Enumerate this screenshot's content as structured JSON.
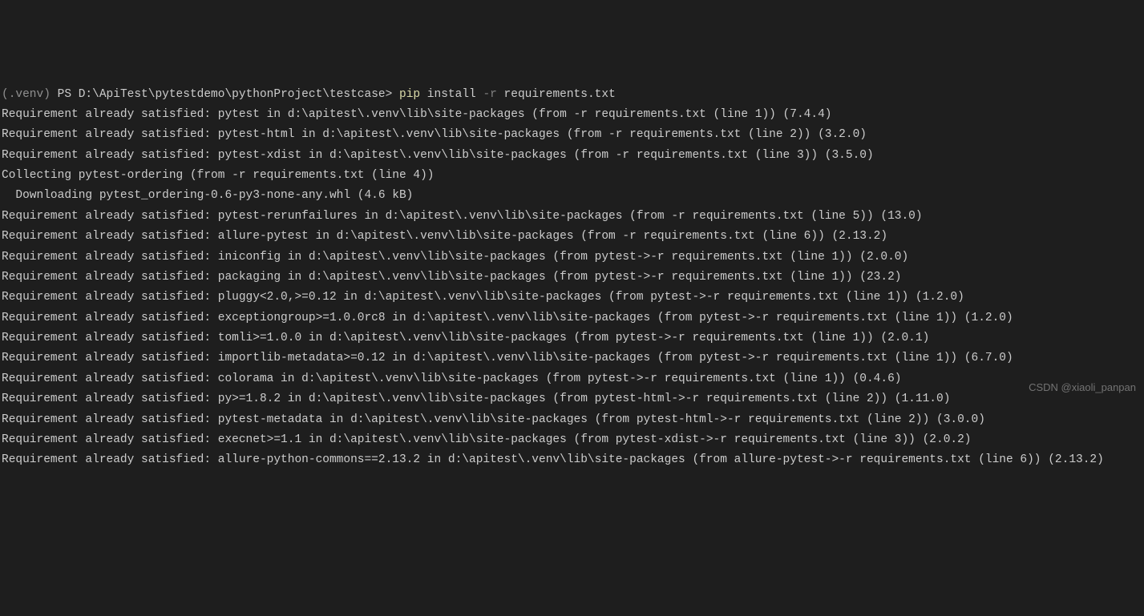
{
  "prompt": {
    "venv": "(.venv) ",
    "shell": "PS ",
    "path": "D:\\ApiTest\\pytestdemo\\pythonProject\\testcase> ",
    "cmd_pip": "pip",
    "cmd_install": " install ",
    "cmd_flag": "-r",
    "cmd_arg": " requirements.txt"
  },
  "lines": {
    "l1": "Requirement already satisfied: pytest in d:\\apitest\\.venv\\lib\\site-packages (from -r requirements.txt (line 1)) (7.4.4)",
    "l2": "Requirement already satisfied: pytest-html in d:\\apitest\\.venv\\lib\\site-packages (from -r requirements.txt (line 2)) (3.2.0)",
    "l3": "Requirement already satisfied: pytest-xdist in d:\\apitest\\.venv\\lib\\site-packages (from -r requirements.txt (line 3)) (3.5.0)",
    "l4": "Collecting pytest-ordering (from -r requirements.txt (line 4))",
    "l5": "  Downloading pytest_ordering-0.6-py3-none-any.whl (4.6 kB)",
    "l6": "Requirement already satisfied: pytest-rerunfailures in d:\\apitest\\.venv\\lib\\site-packages (from -r requirements.txt (line 5)) (13.0)",
    "l7": "Requirement already satisfied: allure-pytest in d:\\apitest\\.venv\\lib\\site-packages (from -r requirements.txt (line 6)) (2.13.2)",
    "l8": "Requirement already satisfied: iniconfig in d:\\apitest\\.venv\\lib\\site-packages (from pytest->-r requirements.txt (line 1)) (2.0.0)",
    "l9": "Requirement already satisfied: packaging in d:\\apitest\\.venv\\lib\\site-packages (from pytest->-r requirements.txt (line 1)) (23.2)",
    "l10": "Requirement already satisfied: pluggy<2.0,>=0.12 in d:\\apitest\\.venv\\lib\\site-packages (from pytest->-r requirements.txt (line 1)) (1.2.0)",
    "l11": "Requirement already satisfied: exceptiongroup>=1.0.0rc8 in d:\\apitest\\.venv\\lib\\site-packages (from pytest->-r requirements.txt (line 1)) (1.2.0)",
    "l12": "Requirement already satisfied: tomli>=1.0.0 in d:\\apitest\\.venv\\lib\\site-packages (from pytest->-r requirements.txt (line 1)) (2.0.1)",
    "l13": "Requirement already satisfied: importlib-metadata>=0.12 in d:\\apitest\\.venv\\lib\\site-packages (from pytest->-r requirements.txt (line 1)) (6.7.0)",
    "l14": "Requirement already satisfied: colorama in d:\\apitest\\.venv\\lib\\site-packages (from pytest->-r requirements.txt (line 1)) (0.4.6)",
    "l15": "Requirement already satisfied: py>=1.8.2 in d:\\apitest\\.venv\\lib\\site-packages (from pytest-html->-r requirements.txt (line 2)) (1.11.0)",
    "l16": "Requirement already satisfied: pytest-metadata in d:\\apitest\\.venv\\lib\\site-packages (from pytest-html->-r requirements.txt (line 2)) (3.0.0)",
    "l17": "Requirement already satisfied: execnet>=1.1 in d:\\apitest\\.venv\\lib\\site-packages (from pytest-xdist->-r requirements.txt (line 3)) (2.0.2)",
    "l18": "Requirement already satisfied: allure-python-commons==2.13.2 in d:\\apitest\\.venv\\lib\\site-packages (from allure-pytest->-r requirements.txt (line 6)) (2.13.2)"
  },
  "watermark": "CSDN @xiaoli_panpan"
}
